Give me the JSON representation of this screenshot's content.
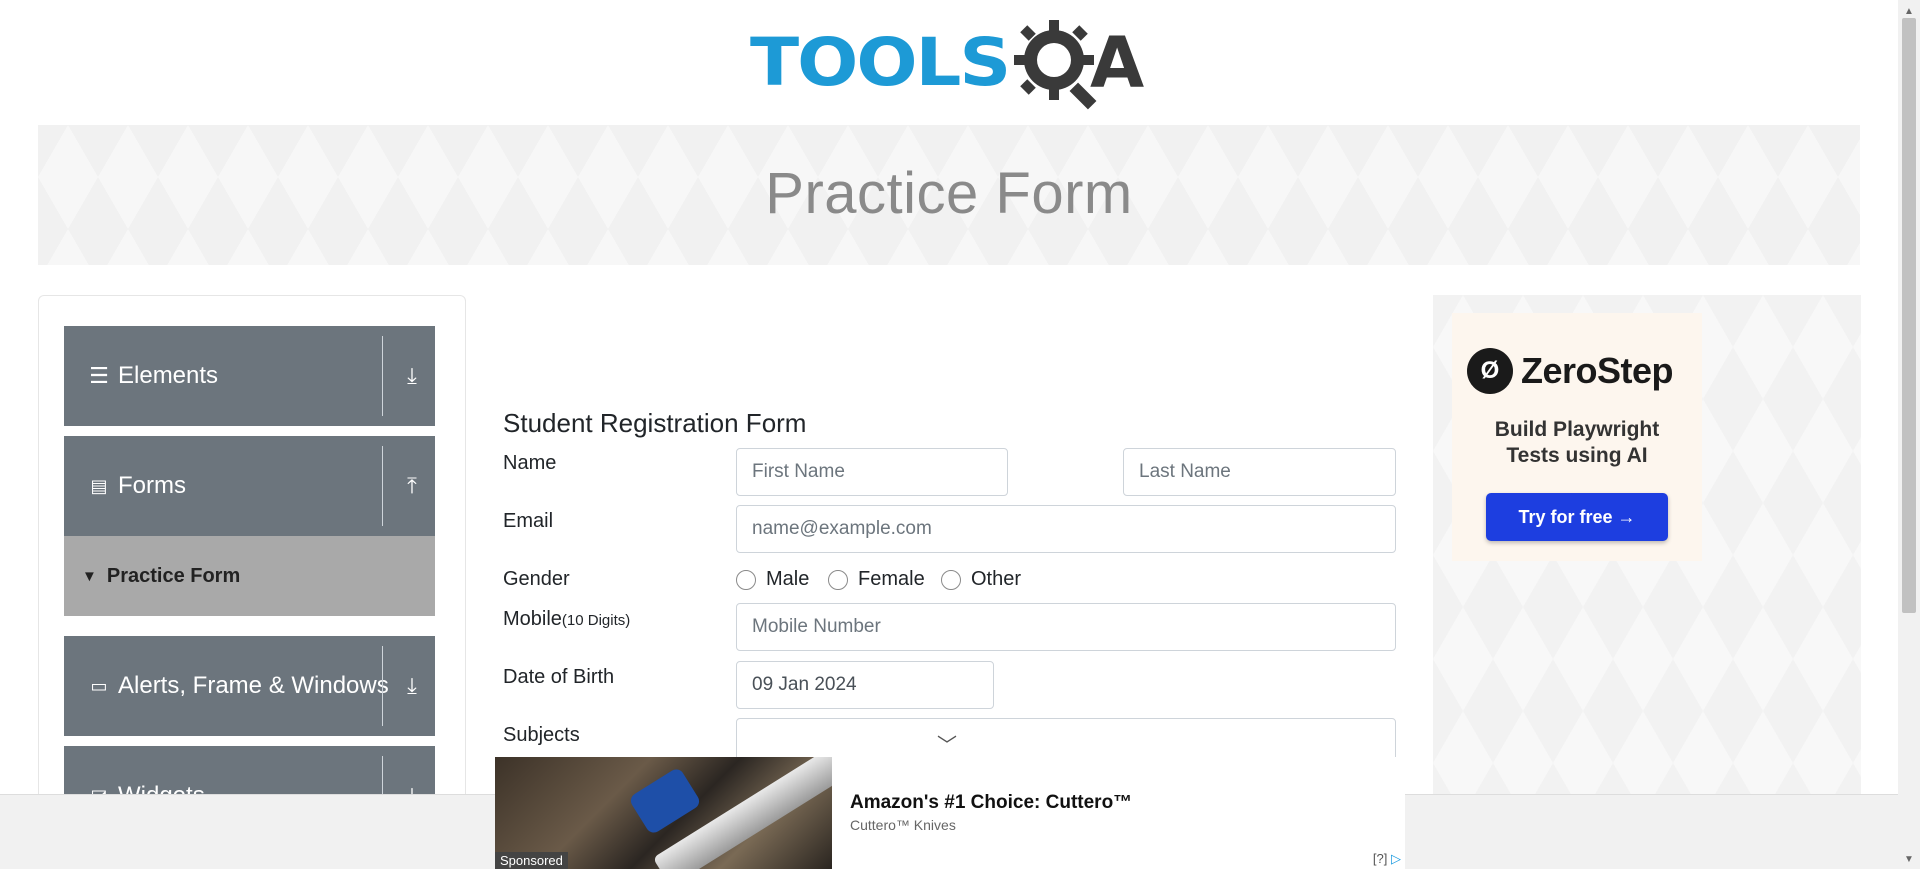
{
  "logo": {
    "tools": "TOOLS",
    "qa": "A",
    "alt": "TOOLSQA"
  },
  "banner": {
    "title": "Practice Form"
  },
  "sidebar": {
    "groups": [
      {
        "label": "Elements",
        "icon": "hamburger-icon",
        "arrow": "download-arrow-icon"
      },
      {
        "label": "Forms",
        "icon": "document-icon",
        "arrow": "upload-arrow-icon"
      },
      {
        "label": "Alerts, Frame & Windows",
        "icon": "window-icon",
        "arrow": "download-arrow-icon"
      },
      {
        "label": "Widgets",
        "icon": "widget-icon",
        "arrow": "download-arrow-icon"
      }
    ],
    "active_item": {
      "label": "Practice Form",
      "icon": "html5-icon"
    }
  },
  "form": {
    "title": "Student Registration Form",
    "name_label": "Name",
    "first_name_placeholder": "First Name",
    "last_name_placeholder": "Last Name",
    "email_label": "Email",
    "email_placeholder": "name@example.com",
    "gender_label": "Gender",
    "gender_options": [
      "Male",
      "Female",
      "Other"
    ],
    "mobile_label": "Mobile",
    "mobile_hint": "(10 Digits)",
    "mobile_placeholder": "Mobile Number",
    "dob_label": "Date of Birth",
    "dob_value": "09 Jan 2024",
    "subjects_label": "Subjects"
  },
  "ad_right": {
    "brand": "ZeroStep",
    "tagline_line1": "Build Playwright",
    "tagline_line2": "Tests using AI",
    "cta": "Try for free →"
  },
  "ad_bottom": {
    "title": "Amazon's #1 Choice: Cuttero™",
    "subtitle": "Cuttero™ Knives",
    "badge": "Sponsored",
    "adchoice": "[?]"
  }
}
